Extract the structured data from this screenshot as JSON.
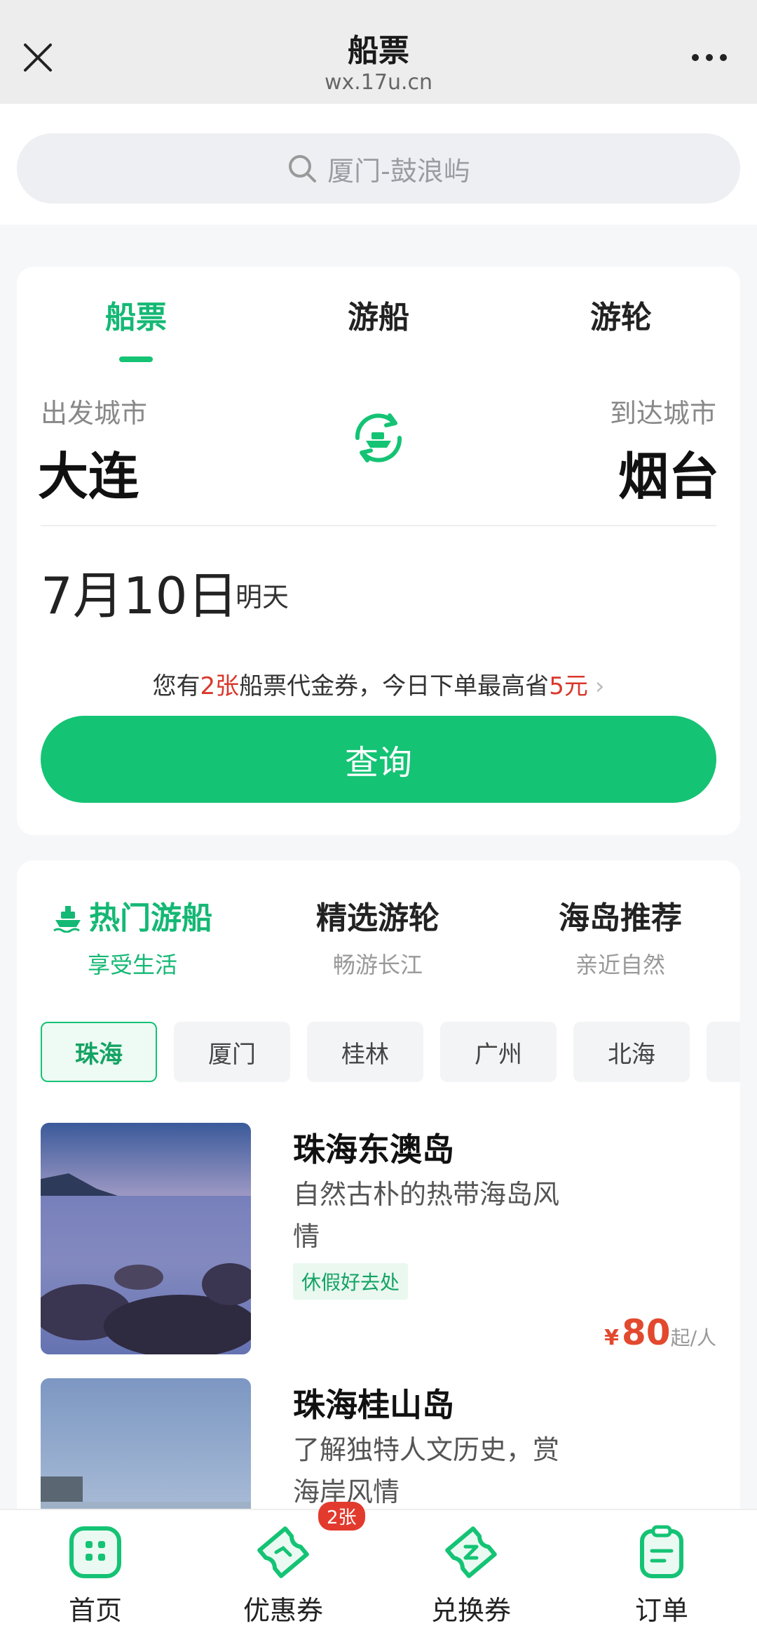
{
  "topbar": {
    "title": "船票",
    "url": "wx.17u.cn"
  },
  "search": {
    "placeholder": "厦门-鼓浪屿"
  },
  "booking": {
    "tabs": [
      "船票",
      "游船",
      "游轮"
    ],
    "from_label": "出发城市",
    "from_city": "大连",
    "to_label": "到达城市",
    "to_city": "烟台",
    "date": "7月10日",
    "date_sub": "明天",
    "coupon": {
      "p1": "您有",
      "count": "2张",
      "p2": "船票代金券，今日下单最高省",
      "save": "5元"
    },
    "query_label": "查询"
  },
  "rec": {
    "categories": [
      {
        "title": "热门游船",
        "sub": "享受生活"
      },
      {
        "title": "精选游轮",
        "sub": "畅游长江"
      },
      {
        "title": "海岛推荐",
        "sub": "亲近自然"
      }
    ],
    "chips": [
      "珠海",
      "厦门",
      "桂林",
      "广州",
      "北海"
    ],
    "items": [
      {
        "name": "珠海东澳岛",
        "desc": "自然古朴的热带海岛风情",
        "tag": "休假好去处",
        "yen": "¥",
        "price": "80",
        "unit": "起/人"
      },
      {
        "name": "珠海桂山岛",
        "desc": "了解独特人文历史，赏海岸风情"
      }
    ]
  },
  "nav": {
    "items": [
      "首页",
      "优惠券",
      "兑换券",
      "订单"
    ],
    "coupon_badge": "2张"
  },
  "colors": {
    "accent": "#14c374",
    "price": "#e2492f"
  }
}
